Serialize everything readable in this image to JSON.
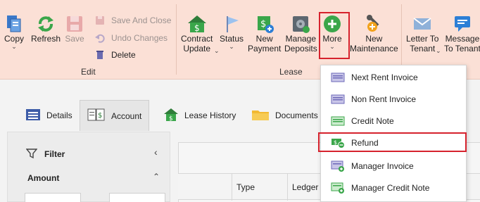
{
  "ribbon": {
    "edit_group": {
      "label": "Edit",
      "copy": "Copy",
      "refresh": "Refresh",
      "save": "Save",
      "save_and_close": "Save And Close",
      "undo_changes": "Undo Changes",
      "delete": "Delete"
    },
    "lease_group": {
      "label": "Lease",
      "contract_update": [
        "Contract",
        "Update"
      ],
      "status": "Status",
      "new_payment": [
        "New",
        "Payment"
      ],
      "manage_deposits": [
        "Manage",
        "Deposits"
      ],
      "more": "More",
      "new_maintenance": [
        "New",
        "Maintenance"
      ]
    },
    "comm_group": {
      "letter_to_tenant": [
        "Letter To",
        "Tenant"
      ],
      "message_to_tenant": [
        "Message",
        "To Tenant"
      ]
    }
  },
  "tabs": [
    {
      "label": "Details"
    },
    {
      "label": "Account"
    },
    {
      "label": "Lease History"
    },
    {
      "label": "Documents"
    }
  ],
  "filter": {
    "title": "Filter",
    "amount_label": "Amount"
  },
  "grid": {
    "columns": [
      "Type",
      "Ledger"
    ]
  },
  "more_menu": {
    "items": [
      {
        "label": "Next Rent Invoice",
        "icon": "invoice-icon"
      },
      {
        "label": "Non Rent Invoice",
        "icon": "invoice-icon"
      },
      {
        "label": "Credit Note",
        "icon": "credit-note-icon"
      },
      {
        "label": "Refund",
        "icon": "refund-icon"
      },
      {
        "label": "Manager Invoice",
        "icon": "invoice-add-icon"
      },
      {
        "label": "Manager Credit Note",
        "icon": "credit-note-add-icon"
      }
    ]
  },
  "colors": {
    "ribbon_bg": "#fbe0d6",
    "highlight": "#d6222d",
    "accent_green": "#3aa64a",
    "accent_blue": "#2f7ad6"
  }
}
